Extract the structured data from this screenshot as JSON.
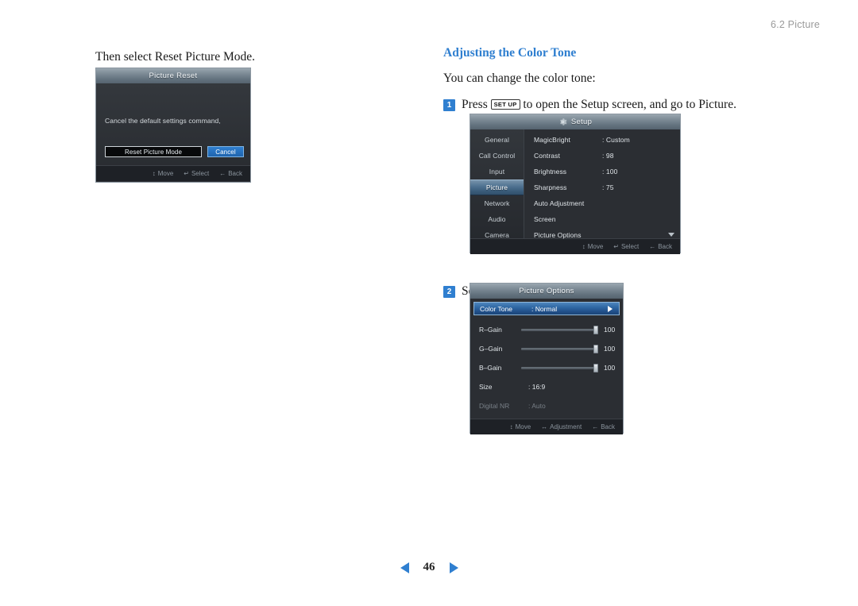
{
  "header": {
    "running_head": "6.2 Picture"
  },
  "left_column": {
    "intro_text": "Then select Reset Picture Mode.",
    "picture_reset_dialog": {
      "title": "Picture Reset",
      "message": "Cancel the default settings command,",
      "buttons": {
        "reset": "Reset Picture Mode",
        "cancel": "Cancel"
      },
      "footer_hints": [
        {
          "glyph": "↕",
          "label": "Move"
        },
        {
          "glyph": "↵",
          "label": "Select"
        },
        {
          "glyph": "←",
          "label": "Back"
        }
      ]
    }
  },
  "right_column": {
    "section_title": "Adjusting the Color Tone",
    "lead_text": "You can change the color tone:",
    "steps": [
      {
        "number": "1",
        "text_before": "Press",
        "key_label": "SET UP",
        "text_after": "to open the Setup screen, and go to Picture."
      },
      {
        "number": "2",
        "text": "Select Picture Options."
      }
    ],
    "setup_menu": {
      "title": "Setup",
      "icon": "gear-icon",
      "sidebar": [
        {
          "label": "General",
          "active": false
        },
        {
          "label": "Call Control",
          "active": false
        },
        {
          "label": "Input",
          "active": false
        },
        {
          "label": "Picture",
          "active": true
        },
        {
          "label": "Network",
          "active": false
        },
        {
          "label": "Audio",
          "active": false
        },
        {
          "label": "Camera",
          "active": false
        }
      ],
      "rows": [
        {
          "label": "MagicBright",
          "value": ": Custom"
        },
        {
          "label": "Contrast",
          "value": ": 98"
        },
        {
          "label": "Brightness",
          "value": ": 100"
        },
        {
          "label": "Sharpness",
          "value": ": 75"
        },
        {
          "label": "Auto Adjustment",
          "value": ""
        },
        {
          "label": "Screen",
          "value": ""
        },
        {
          "label": "Picture Options",
          "value": ""
        }
      ],
      "footer_hints": [
        {
          "glyph": "↕",
          "label": "Move"
        },
        {
          "glyph": "↵",
          "label": "Select"
        },
        {
          "glyph": "←",
          "label": "Back"
        }
      ]
    },
    "picture_options_menu": {
      "title": "Picture Options",
      "highlight_row": {
        "label": "Color Tone",
        "value": ": Normal"
      },
      "sliders": [
        {
          "label": "R–Gain",
          "value": "100",
          "percent": 100
        },
        {
          "label": "G–Gain",
          "value": "100",
          "percent": 100
        },
        {
          "label": "B–Gain",
          "value": "100",
          "percent": 100
        }
      ],
      "rows": [
        {
          "label": "Size",
          "value": ": 16:9",
          "dimmed": false
        },
        {
          "label": "Digital NR",
          "value": ": Auto",
          "dimmed": true
        }
      ],
      "footer_hints": [
        {
          "glyph": "↕",
          "label": "Move"
        },
        {
          "glyph": "↔",
          "label": "Adjustment"
        },
        {
          "glyph": "←",
          "label": "Back"
        }
      ]
    }
  },
  "footer": {
    "page_number": "46",
    "prev_icon": "triangle-left-icon",
    "next_icon": "triangle-right-icon"
  },
  "colors": {
    "accent": "#2f7fd0",
    "header_gray": "#9a9a9a",
    "osd_bg": "#2b2e33"
  }
}
